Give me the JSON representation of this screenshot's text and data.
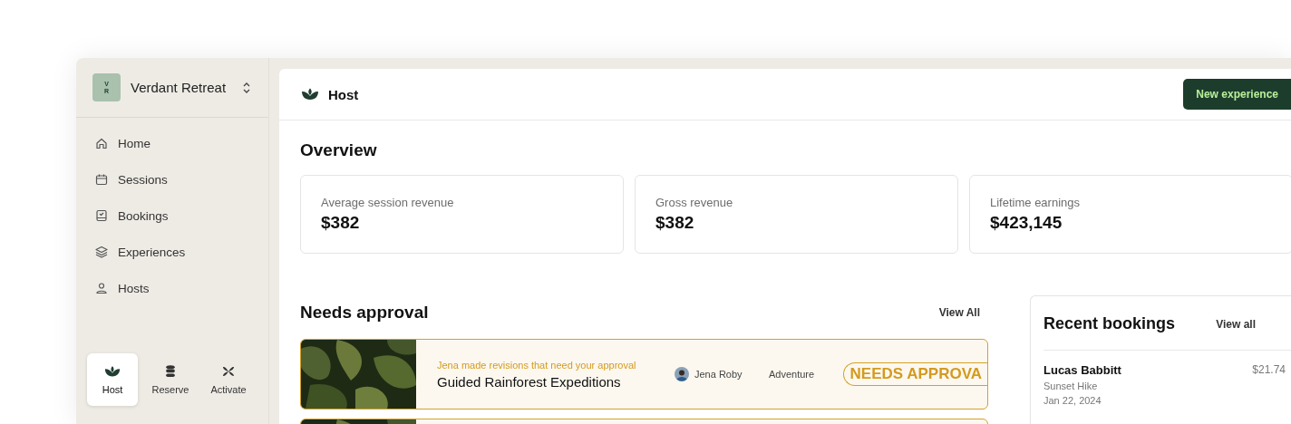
{
  "workspace": {
    "initials": "VR",
    "name": "Verdant Retreat"
  },
  "nav": [
    {
      "label": "Home"
    },
    {
      "label": "Sessions"
    },
    {
      "label": "Bookings"
    },
    {
      "label": "Experiences"
    },
    {
      "label": "Hosts"
    }
  ],
  "apps": [
    {
      "label": "Host",
      "selected": true
    },
    {
      "label": "Reserve",
      "selected": false
    },
    {
      "label": "Activate",
      "selected": false
    }
  ],
  "header": {
    "title": "Host",
    "button": "New experience"
  },
  "overview": {
    "title": "Overview",
    "cards": [
      {
        "label": "Average session revenue",
        "value": "$382"
      },
      {
        "label": "Gross revenue",
        "value": "$382"
      },
      {
        "label": "Lifetime earnings",
        "value": "$423,145"
      }
    ]
  },
  "approval": {
    "title": "Needs approval",
    "link": "View All",
    "items": [
      {
        "kind": "full",
        "note": "Jena made revisions that need your approval",
        "title": "Guided Rainforest Expeditions",
        "host": "Jena Roby",
        "category": "Adventure",
        "badge": "NEEDS APPROVA"
      },
      {
        "kind": "partial"
      }
    ]
  },
  "bookings": {
    "title": "Recent bookings",
    "link": "View all",
    "items": [
      {
        "name": "Lucas Babbitt",
        "amount": "$21.74",
        "experience": "Sunset Hike",
        "date": "Jan 22, 2024"
      }
    ]
  }
}
